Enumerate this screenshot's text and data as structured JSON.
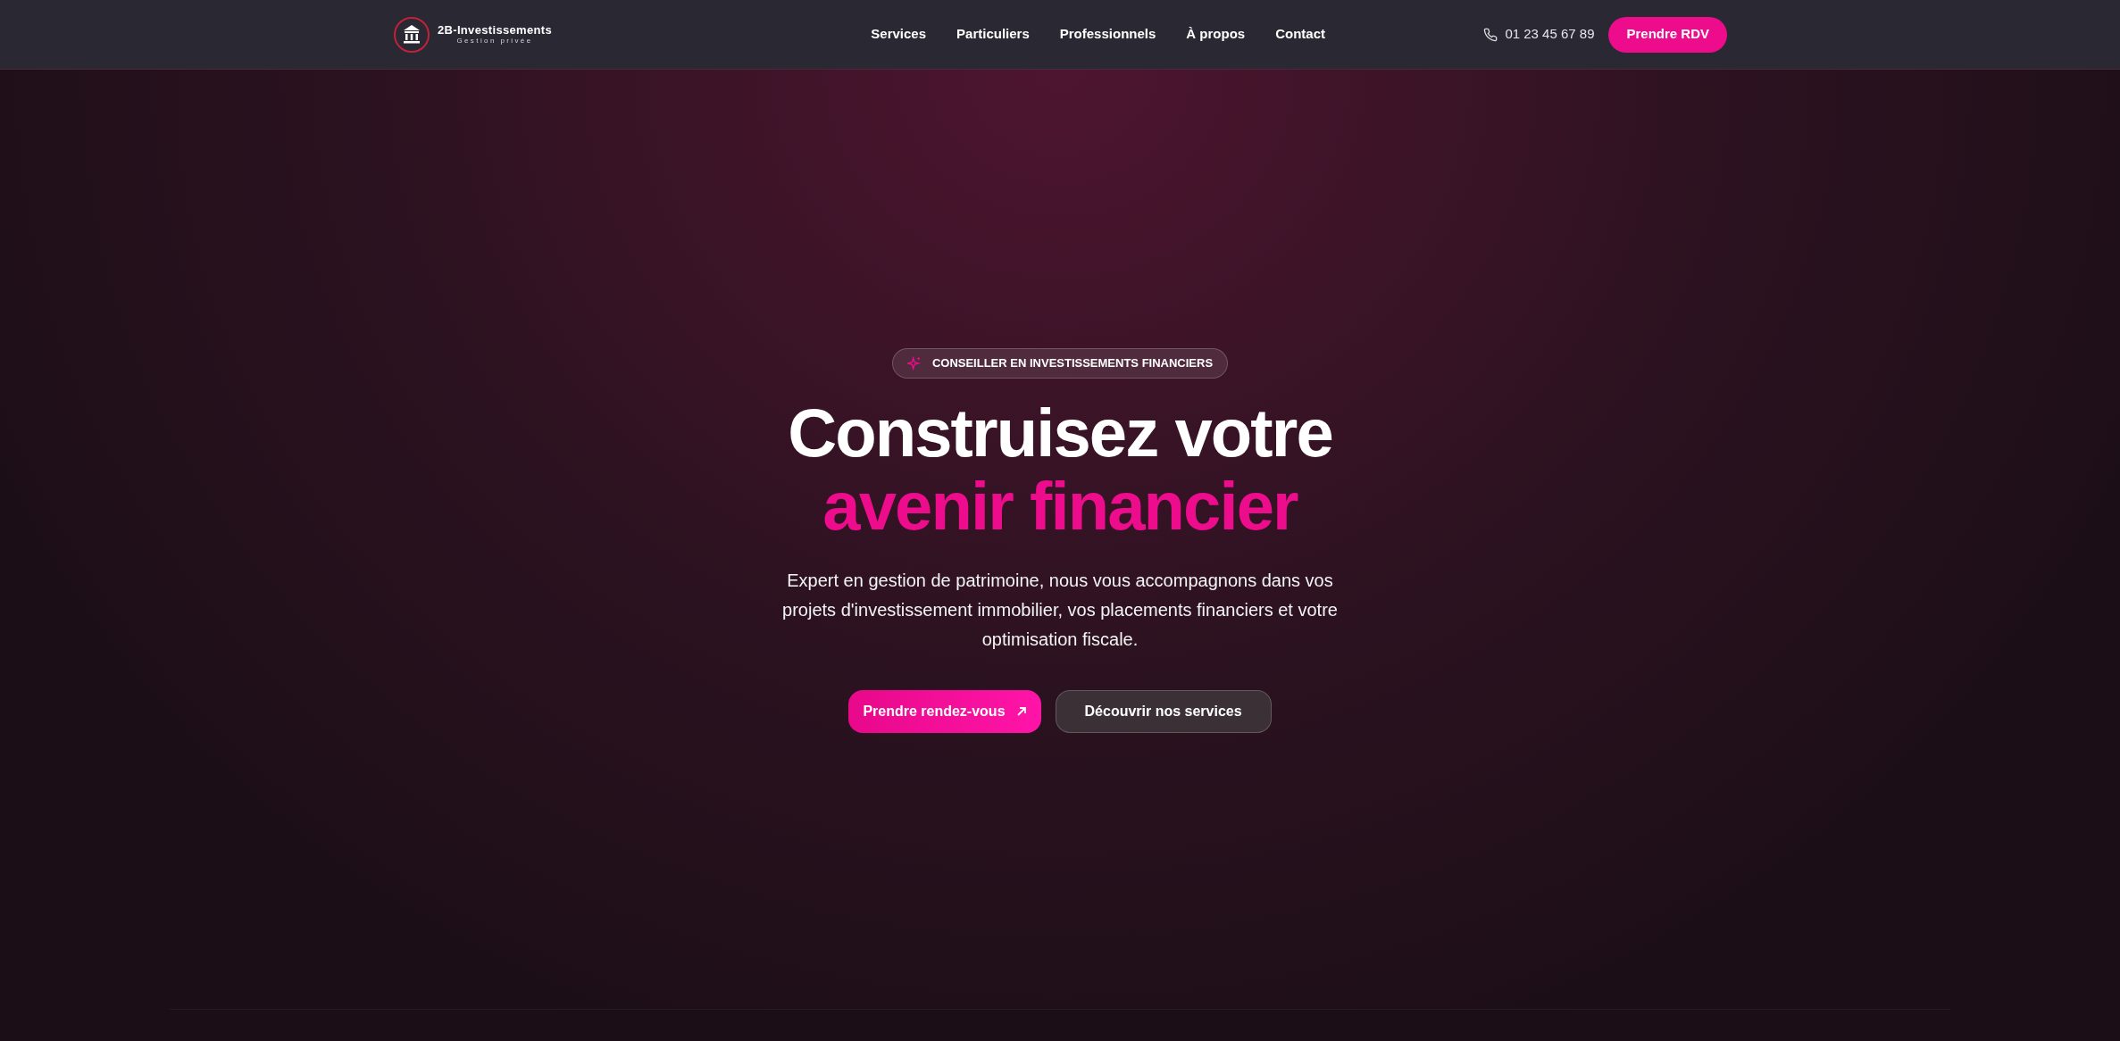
{
  "header": {
    "logo": {
      "name": "2B-Investissements",
      "tagline": "Gestion privée"
    },
    "nav": [
      {
        "label": "Services"
      },
      {
        "label": "Particuliers"
      },
      {
        "label": "Professionnels"
      },
      {
        "label": "À propos"
      },
      {
        "label": "Contact"
      }
    ],
    "phone": "01 23 45 67 89",
    "cta": "Prendre RDV"
  },
  "hero": {
    "badge": "CONSEILLER EN INVESTISSEMENTS FINANCIERS",
    "title_line_1": "Construisez votre",
    "title_line_2": "avenir financier",
    "description": "Expert en gestion de patrimoine, nous vous accompagnons dans vos projets d'investissement immobilier, vos placements financiers et votre optimisation fiscale.",
    "buttons": [
      {
        "label": "Prendre rendez-vous",
        "kind": "primary"
      },
      {
        "label": "Découvrir nos services",
        "kind": "secondary"
      }
    ]
  }
}
